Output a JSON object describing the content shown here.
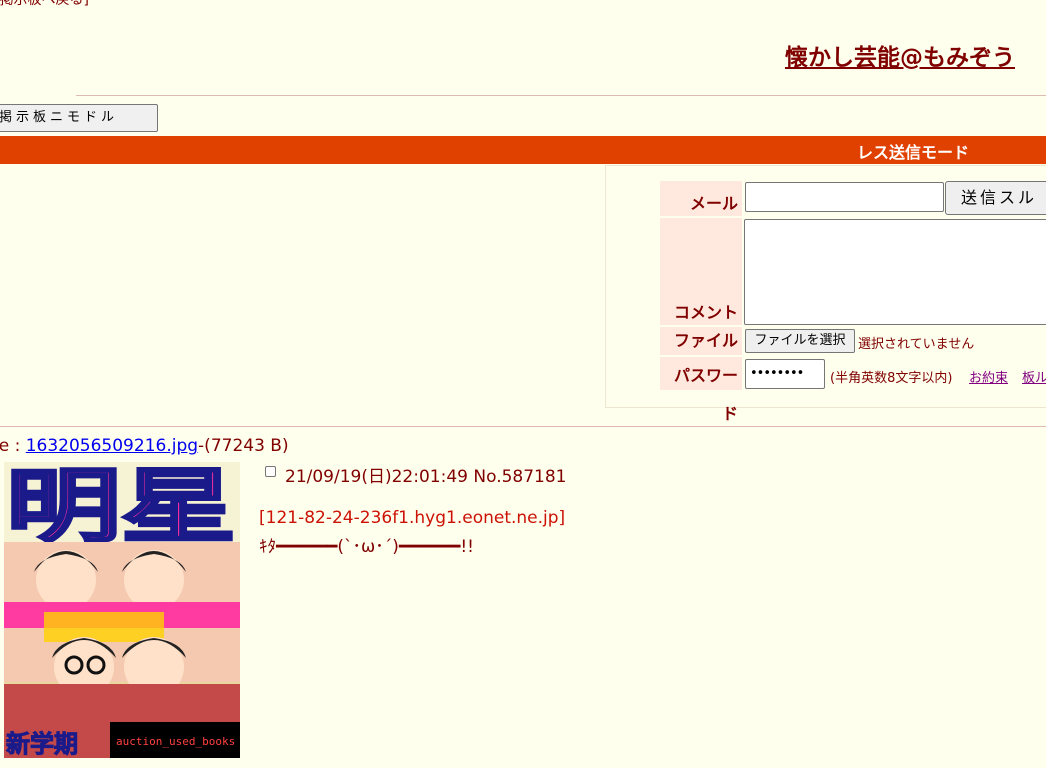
{
  "nav": {
    "top_link": "[掲示板へ戻る]"
  },
  "header": {
    "board_title": "懐かし芸能@もみぞう"
  },
  "mode_switch": {
    "label": "掲示板ニモドル"
  },
  "reply_mode": {
    "label": "レス送信モード"
  },
  "form": {
    "mail_label": "メール",
    "comment_label": "コメント",
    "file_label": "ファイル",
    "password_label": "パスワード",
    "mail_value": "",
    "comment_value": "",
    "submit_label": "送信スル",
    "file_button_label": "ファイルを選択",
    "file_status": "選択されていません",
    "password_value": "••••••••",
    "password_note": "(半角英数8文字以内)",
    "rules_link": "お約束",
    "board_rules_link": "板ル"
  },
  "post": {
    "file_prefix": "le : ",
    "file_name": "1632056509216.jpg",
    "file_size": "-(77243 B)",
    "date_no": "21/09/19(日)22:01:49 No.587181",
    "ip": "[121-82-24-236f1.hyg1.eonet.ne.jp]",
    "body": "ｷﾀ━━━━━━(`･ω･´)━━━━━━!!",
    "thumbnail": {
      "magazine_title": "明星",
      "caption": "auction_used_books",
      "corner_text": "新学期"
    }
  },
  "colors": {
    "background": "#ffffee",
    "text": "#800000",
    "mode_bar": "#e04000",
    "label_bg": "#ffe9de",
    "ip_text": "#cc1105",
    "link": "#0000ee",
    "visited_link": "#800080"
  }
}
